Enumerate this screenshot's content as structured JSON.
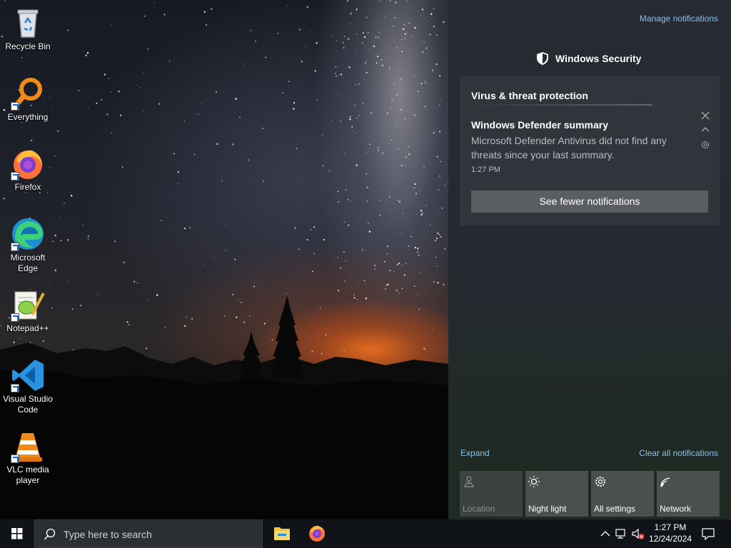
{
  "desktop": {
    "icons": [
      {
        "label": "Recycle Bin",
        "icon": "recycle-bin-icon"
      },
      {
        "label": "Everything",
        "icon": "everything-search-icon"
      },
      {
        "label": "Firefox",
        "icon": "firefox-icon"
      },
      {
        "label": "Microsoft Edge",
        "icon": "edge-icon"
      },
      {
        "label": "Notepad++",
        "icon": "notepadpp-icon"
      },
      {
        "label": "Visual Studio Code",
        "icon": "vscode-icon"
      },
      {
        "label": "VLC media player",
        "icon": "vlc-icon"
      }
    ]
  },
  "action_center": {
    "manage_link": "Manage notifications",
    "app_name": "Windows Security",
    "group_title": "Virus & threat protection",
    "notification": {
      "title": "Windows Defender summary",
      "body": "Microsoft Defender Antivirus did not find any threats since your last summary.",
      "time": "1:27 PM",
      "button": "See fewer notifications"
    },
    "expand_link": "Expand",
    "clear_link": "Clear all notifications",
    "quick_actions": [
      {
        "label": "Location",
        "icon": "location-icon",
        "state": "disabled"
      },
      {
        "label": "Night light",
        "icon": "night-light-icon",
        "state": "off"
      },
      {
        "label": "All settings",
        "icon": "settings-gear-icon",
        "state": "off"
      },
      {
        "label": "Network",
        "icon": "network-wifi-icon",
        "state": "off"
      }
    ]
  },
  "taskbar": {
    "search_placeholder": "Type here to search",
    "pinned": [
      "file-explorer-icon",
      "firefox-icon"
    ],
    "clock": {
      "time": "1:27 PM",
      "date": "12/24/2024"
    }
  },
  "colors": {
    "accent_link": "#8fbfe8",
    "panel_bg": "#262b33",
    "card_bg": "#30353c",
    "taskbar_bg": "#101418"
  }
}
